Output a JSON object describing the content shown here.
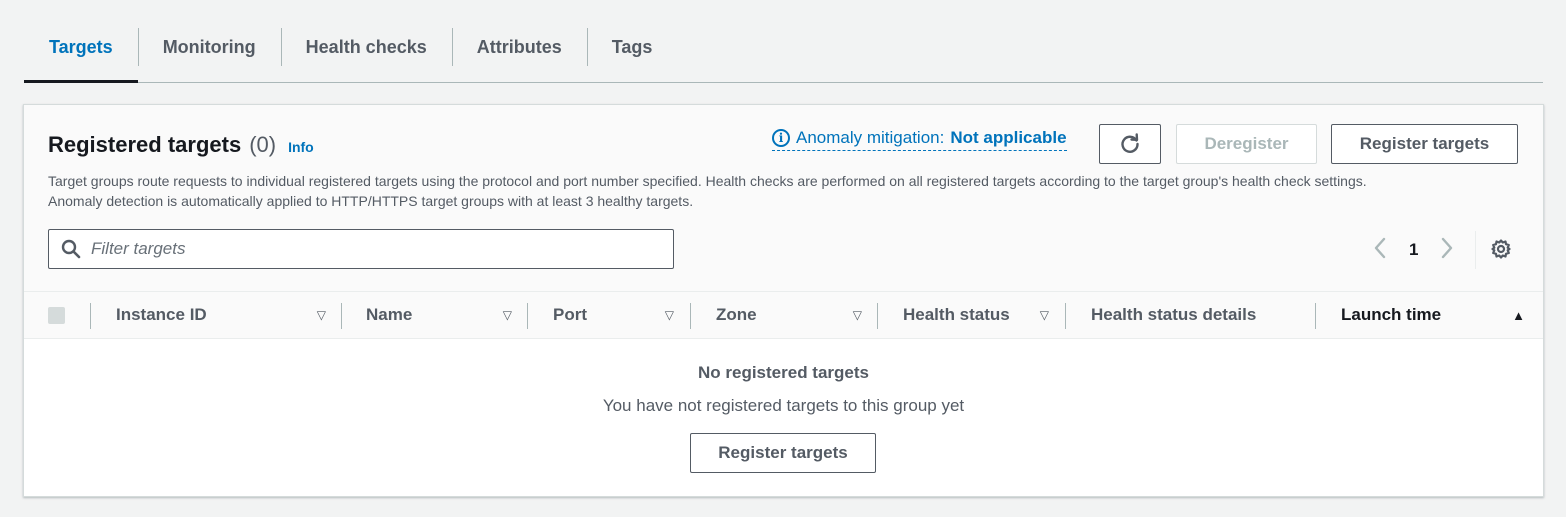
{
  "tabs": [
    {
      "label": "Targets"
    },
    {
      "label": "Monitoring"
    },
    {
      "label": "Health checks"
    },
    {
      "label": "Attributes"
    },
    {
      "label": "Tags"
    }
  ],
  "active_tab": "Targets",
  "panel": {
    "title": "Registered targets",
    "count": "(0)",
    "info_link": "Info",
    "description_line1": "Target groups route requests to individual registered targets using the protocol and port number specified. Health checks are performed on all registered targets according to the target group's health check settings.",
    "description_line2": "Anomaly detection is automatically applied to HTTP/HTTPS target groups with at least 3 healthy targets.",
    "anomaly_label": "Anomaly mitigation:",
    "anomaly_value": "Not applicable",
    "refresh_icon": "refresh-icon",
    "deregister_label": "Deregister",
    "register_label": "Register targets"
  },
  "filter": {
    "placeholder": "Filter targets",
    "icon": "search-icon"
  },
  "pagination": {
    "current_page": "1",
    "prev_icon": "chevron-left-icon",
    "next_icon": "chevron-right-icon",
    "settings_icon": "gear-icon"
  },
  "table": {
    "columns": [
      {
        "label": "Instance ID",
        "sort": "filter-caret"
      },
      {
        "label": "Name",
        "sort": "filter-caret"
      },
      {
        "label": "Port",
        "sort": "filter-caret"
      },
      {
        "label": "Zone",
        "sort": "filter-caret"
      },
      {
        "label": "Health status",
        "sort": "filter-caret"
      },
      {
        "label": "Health status details",
        "sort": "none"
      },
      {
        "label": "Launch time",
        "sort": "ascending"
      }
    ]
  },
  "empty_state": {
    "title": "No registered targets",
    "subtitle": "You have not registered targets to this group yet",
    "button_label": "Register targets"
  },
  "colors": {
    "accent": "#0073bb",
    "text": "#16191f",
    "muted": "#545b64",
    "background": "#f2f3f3"
  }
}
